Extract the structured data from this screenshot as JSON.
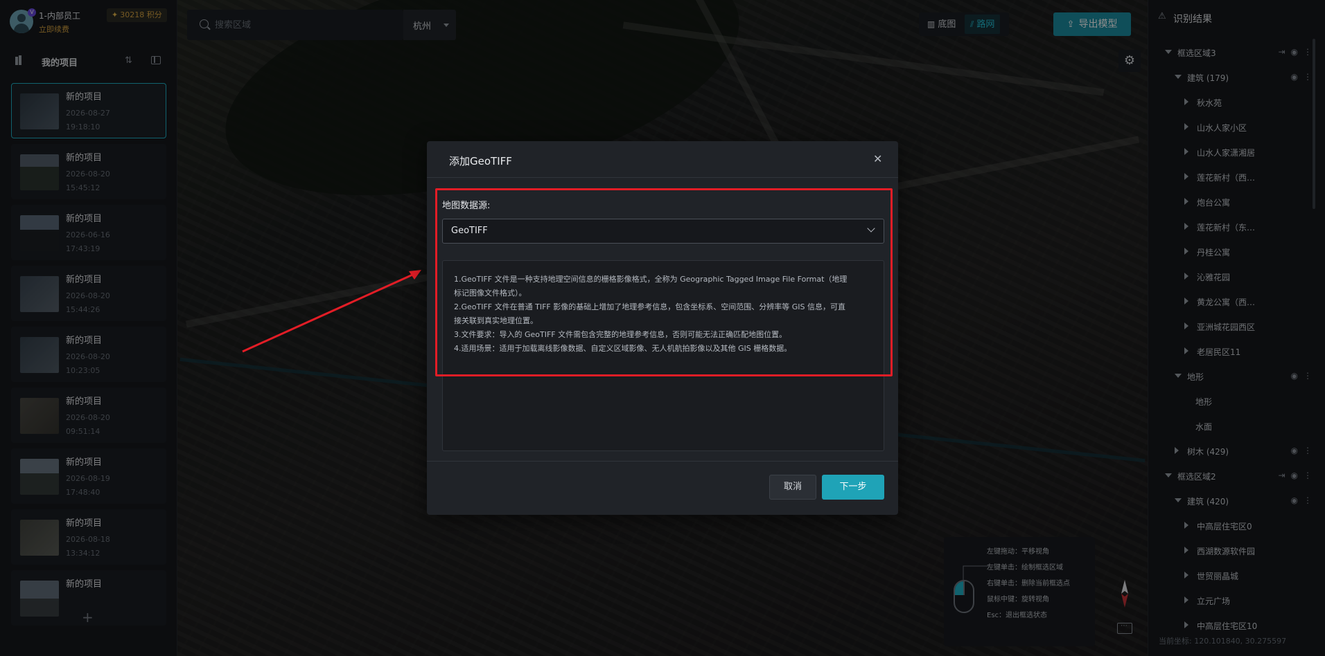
{
  "user": {
    "name": "1-内部员工",
    "badge": "V",
    "renew_label": "立即续费",
    "points": "30218 积分"
  },
  "projects": {
    "title": "我的项目",
    "items": [
      {
        "name": "新的项目",
        "date": "2026-08-27",
        "time": "19:18:10",
        "active": true
      },
      {
        "name": "新的项目",
        "date": "2026-08-20",
        "time": "15:45:12"
      },
      {
        "name": "新的项目",
        "date": "2026-06-16",
        "time": "17:43:19"
      },
      {
        "name": "新的项目",
        "date": "2026-08-20",
        "time": "15:44:26"
      },
      {
        "name": "新的项目",
        "date": "2026-08-20",
        "time": "10:23:05"
      },
      {
        "name": "新的项目",
        "date": "2026-08-20",
        "time": "09:51:14"
      },
      {
        "name": "新的项目",
        "date": "2026-08-19",
        "time": "17:48:40"
      },
      {
        "name": "新的项目",
        "date": "2026-08-18",
        "time": "13:34:12"
      },
      {
        "name": "新的项目",
        "date": "",
        "time": ""
      }
    ],
    "add_label": "+"
  },
  "map": {
    "search_placeholder": "搜索区域",
    "city": "杭州",
    "basemap_label": "底图",
    "roadnet_label": "路网",
    "export_label": "导出模型",
    "help": [
      "左键拖动：平移视角",
      "左键单击：绘制框选区域",
      "右键单击：删除当前框选点",
      "鼠标中键：旋转视角",
      "Esc：退出框选状态"
    ]
  },
  "results": {
    "title": "识别结果",
    "tree": [
      {
        "label": "框选区域3",
        "level": 0,
        "expanded": true,
        "actions": [
          "exit",
          "eye",
          "more"
        ]
      },
      {
        "label": "建筑 (179)",
        "level": 1,
        "expanded": true,
        "actions": [
          "eye",
          "more"
        ]
      },
      {
        "label": "秋水苑",
        "level": 2,
        "expanded": false
      },
      {
        "label": "山水人家小区",
        "level": 2,
        "expanded": false
      },
      {
        "label": "山水人家潇湘居",
        "level": 2,
        "expanded": false
      },
      {
        "label": "莲花新村（西…",
        "level": 2,
        "expanded": false
      },
      {
        "label": "炮台公寓",
        "level": 2,
        "expanded": false
      },
      {
        "label": "莲花新村（东…",
        "level": 2,
        "expanded": false
      },
      {
        "label": "丹桂公寓",
        "level": 2,
        "expanded": false
      },
      {
        "label": "沁雅花园",
        "level": 2,
        "expanded": false
      },
      {
        "label": "黄龙公寓（西…",
        "level": 2,
        "expanded": false
      },
      {
        "label": "亚洲城花园西区",
        "level": 2,
        "expanded": false
      },
      {
        "label": "老居民区11",
        "level": 2,
        "expanded": false
      },
      {
        "label": "地形",
        "level": 1,
        "expanded": true,
        "actions": [
          "eye",
          "more"
        ]
      },
      {
        "label": "地形",
        "level": 3,
        "expanded": null
      },
      {
        "label": "水面",
        "level": 3,
        "expanded": null
      },
      {
        "label": "树木 (429)",
        "level": 1,
        "expanded": false,
        "actions": [
          "eye",
          "more"
        ]
      },
      {
        "label": "框选区域2",
        "level": 0,
        "expanded": true,
        "actions": [
          "exit",
          "eye",
          "more"
        ]
      },
      {
        "label": "建筑 (420)",
        "level": 1,
        "expanded": true,
        "actions": [
          "eye",
          "more"
        ]
      },
      {
        "label": "中高层住宅区0",
        "level": 2,
        "expanded": false
      },
      {
        "label": "西湖数源软件园",
        "level": 2,
        "expanded": false
      },
      {
        "label": "世贸丽晶城",
        "level": 2,
        "expanded": false
      },
      {
        "label": "立元广场",
        "level": 2,
        "expanded": false
      },
      {
        "label": "中高层住宅区10",
        "level": 2,
        "expanded": false
      }
    ],
    "coords": "当前坐标: 120.101840, 30.275597"
  },
  "modal": {
    "title": "添加GeoTIFF",
    "source_label": "地图数据源:",
    "source_value": "GeoTIFF",
    "description": [
      "1.GeoTIFF 文件是一种支持地理空间信息的栅格影像格式，全称为 Geographic Tagged Image File Format（地理",
      "标记图像文件格式）。",
      "2.GeoTIFF 文件在普通 TIFF 影像的基础上增加了地理参考信息，包含坐标系、空间范围、分辨率等 GIS 信息，可直",
      "接关联到真实地理位置。",
      "3.文件要求：导入的 GeoTIFF 文件需包含完整的地理参考信息，否则可能无法正确匹配地图位置。",
      "4.适用场景：适用于加载离线影像数据、自定义区域影像、无人机航拍影像以及其他 GIS 栅格数据。"
    ],
    "cancel_label": "取消",
    "next_label": "下一步"
  },
  "colors": {
    "accent": "#1fa3b7",
    "highlight_border": "#e21d26",
    "gold": "#d9a441"
  }
}
